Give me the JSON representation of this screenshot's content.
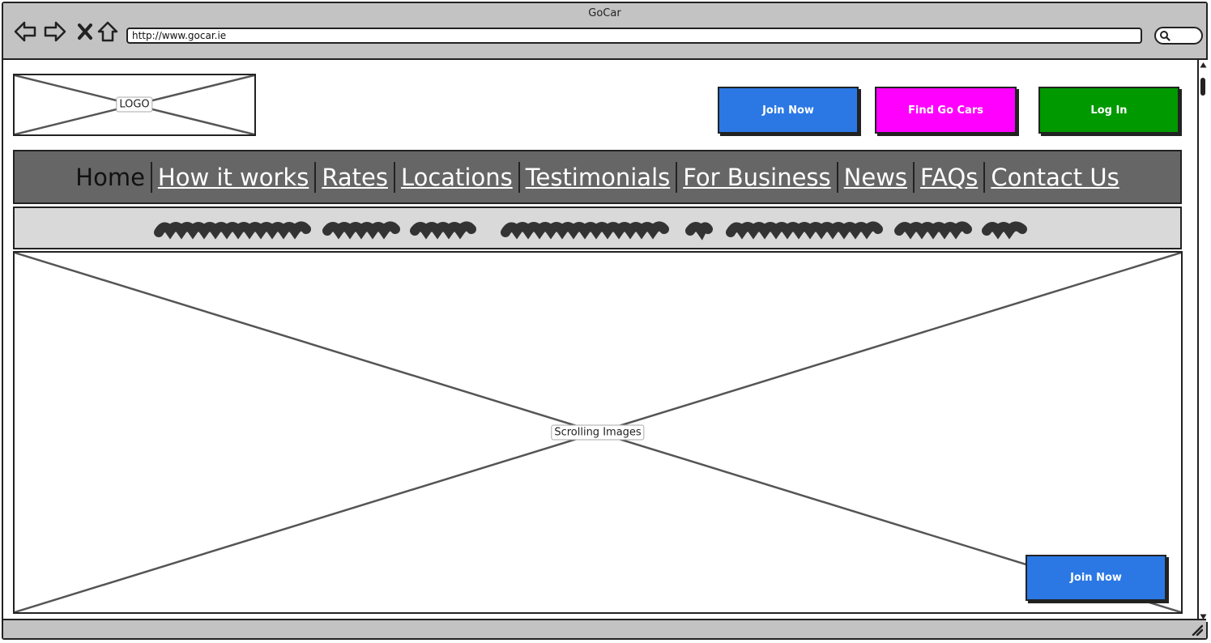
{
  "window": {
    "title": "GoCar"
  },
  "browser": {
    "url": "http://www.gocar.ie"
  },
  "header": {
    "logo_label": "LOGO",
    "buttons": [
      {
        "label": "Join Now",
        "color": "#2b78e4"
      },
      {
        "label": "Find Go Cars",
        "color": "#ff00ff"
      },
      {
        "label": "Log In",
        "color": "#009900"
      }
    ]
  },
  "nav": {
    "items": [
      {
        "label": "Home",
        "active": true
      },
      {
        "label": "How it works"
      },
      {
        "label": "Rates"
      },
      {
        "label": "Locations"
      },
      {
        "label": "Testimonials"
      },
      {
        "label": "For Business"
      },
      {
        "label": "News"
      },
      {
        "label": "FAQs"
      },
      {
        "label": "Contact Us"
      }
    ]
  },
  "hero": {
    "placeholder_label": "Scrolling Images",
    "cta_label": "Join Now"
  },
  "colors": {
    "chrome": "#c3c3c3",
    "nav_bg": "#666666",
    "tagline_bg": "#d9d9d9"
  }
}
